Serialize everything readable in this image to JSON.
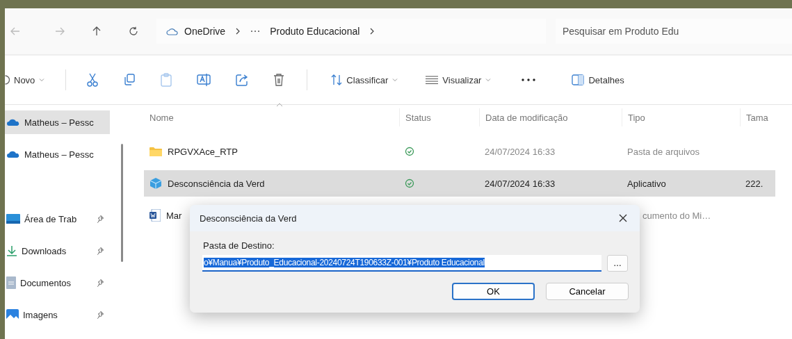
{
  "address_bar": {
    "breadcrumb": [
      "OneDrive",
      "Produto Educacional"
    ],
    "search": {
      "placeholder": "Pesquisar em Produto Edu"
    }
  },
  "toolbar": {
    "new_label": "Novo",
    "sort_label": "Classificar",
    "view_label": "Visualizar",
    "details_label": "Detalhes"
  },
  "sidebar": {
    "items": [
      {
        "label": "Matheus – Pessc",
        "kind": "cloud",
        "pinned": false,
        "selected": true
      },
      {
        "label": "Matheus – Pessc",
        "kind": "cloud",
        "pinned": false,
        "selected": false
      },
      {
        "label": "Área de Trab",
        "kind": "desktop",
        "pinned": true,
        "selected": false
      },
      {
        "label": "Downloads",
        "kind": "download",
        "pinned": true,
        "selected": false
      },
      {
        "label": "Documentos",
        "kind": "documents",
        "pinned": true,
        "selected": false
      },
      {
        "label": "Imagens",
        "kind": "pictures",
        "pinned": true,
        "selected": false
      }
    ]
  },
  "file_list": {
    "columns": [
      "Nome",
      "Status",
      "Data de modificação",
      "Tipo",
      "Tama"
    ],
    "rows": [
      {
        "kind": "folder",
        "name": "RPGVXAce_RTP",
        "synced": true,
        "date": "24/07/2024 16:33",
        "type": "Pasta de arquivos",
        "selected": false
      },
      {
        "kind": "app",
        "name": "Desconsciência da Verd",
        "synced": true,
        "date": "24/07/2024 16:33",
        "type": "Aplicativo",
        "size": "222.",
        "selected": true
      },
      {
        "kind": "word",
        "name": "Mar",
        "type": "cumento do Mi…",
        "selected": false
      }
    ]
  },
  "dialog": {
    "title": "Desconsciência da Verd",
    "label": "Pasta de Destino:",
    "path": "o¥Manua¥Produto_Educacional-20240724T190633Z-001¥Produto Educacional",
    "browse_label": "…",
    "buttons": [
      {
        "label": "OK",
        "default": true
      },
      {
        "label": "Cancelar",
        "default": false
      }
    ]
  }
}
